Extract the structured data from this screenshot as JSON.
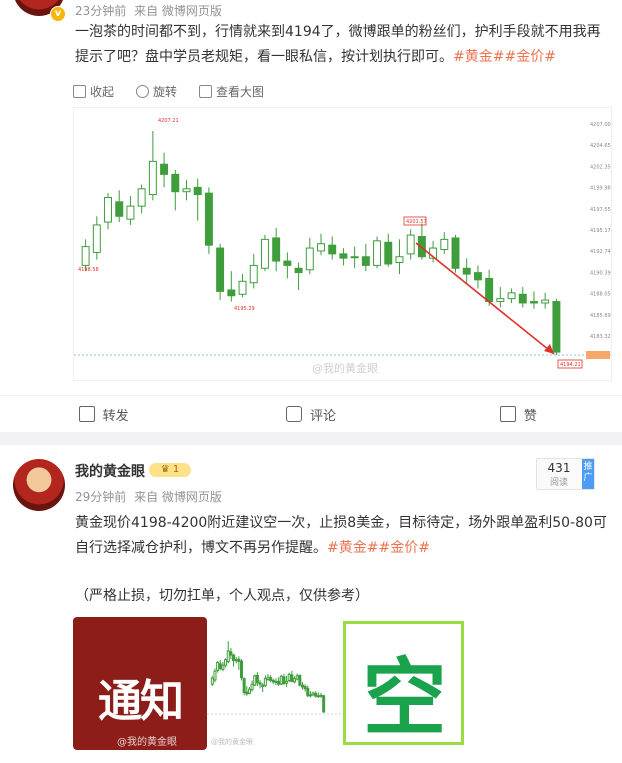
{
  "post1": {
    "time": "23分钟前",
    "source": "来自 微博网页版",
    "text": "一泡茶的时间都不到，行情就来到4194了，微博跟单的粉丝们，护利手段就不用我再提示了吧？盘中学员老规矩，看一眼私信，按计划执行即可。",
    "tags": "#黄金##金价#",
    "toolbar": {
      "collect": "收起",
      "rotate": "旋转",
      "view_large": "查看大图"
    },
    "chart_watermark": "@我的黄金眼",
    "chart_price_labels": [
      "4207.00",
      "4204.65",
      "4202.35",
      "4199.98",
      "4197.55",
      "4195.17",
      "4192.74",
      "4190.39",
      "4188.05",
      "4185.69",
      "4183.32"
    ],
    "chart_high_label": "4207.21",
    "chart_mid_label": "4201.57",
    "chart_low_label": "4195.29",
    "chart_left_label": "4198.58",
    "chart_last_label": "4194.21",
    "actions": {
      "repost": "转发",
      "comment": "评论",
      "like": "赞"
    }
  },
  "post2": {
    "username": "我的黄金眼",
    "level": "1",
    "time": "29分钟前",
    "source": "来自 微博网页版",
    "text": "黄金现价4198-4200附近建议空一次，止损8美金，目标待定，场外跟单盈利50-80可自行选择减仓护利，博文不再另作提醒。",
    "tags": "#黄金##金价#",
    "note": "（严格止损，切勿扛单，个人观点，仅供参考）",
    "reads": "431",
    "reads_label": "阅读",
    "promo": "推广",
    "thumb1_text": "通知",
    "thumb3_text": "空",
    "thumb_watermark": "@我的黄金眼"
  },
  "chart_data": {
    "type": "candlestick",
    "candles": [
      {
        "o": 4197.6,
        "c": 4198.9,
        "h": 4199.4,
        "l": 4197.2
      },
      {
        "o": 4198.5,
        "c": 4200.4,
        "h": 4201.0,
        "l": 4198.0
      },
      {
        "o": 4200.6,
        "c": 4202.3,
        "h": 4202.6,
        "l": 4200.1
      },
      {
        "o": 4202.0,
        "c": 4201.0,
        "h": 4202.8,
        "l": 4200.6
      },
      {
        "o": 4200.8,
        "c": 4201.7,
        "h": 4202.4,
        "l": 4200.4
      },
      {
        "o": 4201.7,
        "c": 4202.9,
        "h": 4203.2,
        "l": 4201.2
      },
      {
        "o": 4202.5,
        "c": 4204.8,
        "h": 4206.9,
        "l": 4202.1
      },
      {
        "o": 4204.6,
        "c": 4203.9,
        "h": 4205.4,
        "l": 4203.0
      },
      {
        "o": 4203.9,
        "c": 4202.7,
        "h": 4204.2,
        "l": 4201.4
      },
      {
        "o": 4202.7,
        "c": 4202.9,
        "h": 4203.5,
        "l": 4202.1
      },
      {
        "o": 4203.0,
        "c": 4202.5,
        "h": 4203.6,
        "l": 4200.7
      },
      {
        "o": 4202.6,
        "c": 4199.0,
        "h": 4203.0,
        "l": 4198.4
      },
      {
        "o": 4198.8,
        "c": 4195.8,
        "h": 4199.1,
        "l": 4195.2
      },
      {
        "o": 4195.9,
        "c": 4195.5,
        "h": 4197.2,
        "l": 4195.1
      },
      {
        "o": 4195.6,
        "c": 4196.5,
        "h": 4197.0,
        "l": 4195.4
      },
      {
        "o": 4196.4,
        "c": 4197.6,
        "h": 4198.4,
        "l": 4196.0
      },
      {
        "o": 4197.4,
        "c": 4199.4,
        "h": 4199.7,
        "l": 4197.2
      },
      {
        "o": 4199.5,
        "c": 4197.9,
        "h": 4200.2,
        "l": 4197.2
      },
      {
        "o": 4197.9,
        "c": 4197.6,
        "h": 4198.5,
        "l": 4196.7
      },
      {
        "o": 4197.4,
        "c": 4197.1,
        "h": 4197.8,
        "l": 4195.9
      },
      {
        "o": 4197.3,
        "c": 4198.8,
        "h": 4199.5,
        "l": 4197.0
      },
      {
        "o": 4198.6,
        "c": 4199.1,
        "h": 4199.8,
        "l": 4198.3
      },
      {
        "o": 4199.0,
        "c": 4198.4,
        "h": 4199.6,
        "l": 4198.0
      },
      {
        "o": 4198.4,
        "c": 4198.1,
        "h": 4198.8,
        "l": 4197.6
      },
      {
        "o": 4198.2,
        "c": 4198.2,
        "h": 4198.9,
        "l": 4197.4
      },
      {
        "o": 4198.2,
        "c": 4197.6,
        "h": 4199.1,
        "l": 4197.2
      },
      {
        "o": 4197.6,
        "c": 4199.3,
        "h": 4199.6,
        "l": 4197.4
      },
      {
        "o": 4199.2,
        "c": 4197.7,
        "h": 4199.8,
        "l": 4197.5
      },
      {
        "o": 4197.8,
        "c": 4198.2,
        "h": 4199.4,
        "l": 4197.0
      },
      {
        "o": 4198.4,
        "c": 4199.7,
        "h": 4200.1,
        "l": 4198.0
      },
      {
        "o": 4199.6,
        "c": 4198.2,
        "h": 4200.5,
        "l": 4198.0
      },
      {
        "o": 4198.1,
        "c": 4198.8,
        "h": 4199.3,
        "l": 4197.8
      },
      {
        "o": 4198.7,
        "c": 4199.4,
        "h": 4199.9,
        "l": 4198.4
      },
      {
        "o": 4199.5,
        "c": 4197.4,
        "h": 4199.7,
        "l": 4197.1
      },
      {
        "o": 4197.4,
        "c": 4197.0,
        "h": 4198.1,
        "l": 4196.4
      },
      {
        "o": 4197.1,
        "c": 4196.6,
        "h": 4197.6,
        "l": 4196.0
      },
      {
        "o": 4196.7,
        "c": 4195.1,
        "h": 4197.3,
        "l": 4194.8
      },
      {
        "o": 4195.1,
        "c": 4195.3,
        "h": 4196.1,
        "l": 4194.7
      },
      {
        "o": 4195.3,
        "c": 4195.7,
        "h": 4196.0,
        "l": 4195.0
      },
      {
        "o": 4195.6,
        "c": 4195.0,
        "h": 4196.1,
        "l": 4194.7
      },
      {
        "o": 4195.1,
        "c": 4195.0,
        "h": 4195.8,
        "l": 4194.6
      },
      {
        "o": 4195.0,
        "c": 4195.2,
        "h": 4195.7,
        "l": 4194.6
      },
      {
        "o": 4195.1,
        "c": 4191.6,
        "h": 4195.3,
        "l": 4191.4
      }
    ],
    "ylim": [
      4190.5,
      4207.8
    ],
    "up_color": "#ffffff",
    "down_color": "#3f9d3c",
    "arrow_color": "#e0302a"
  },
  "colors": {
    "tag": "#eb7350",
    "accent_green": "#1aa24c"
  }
}
